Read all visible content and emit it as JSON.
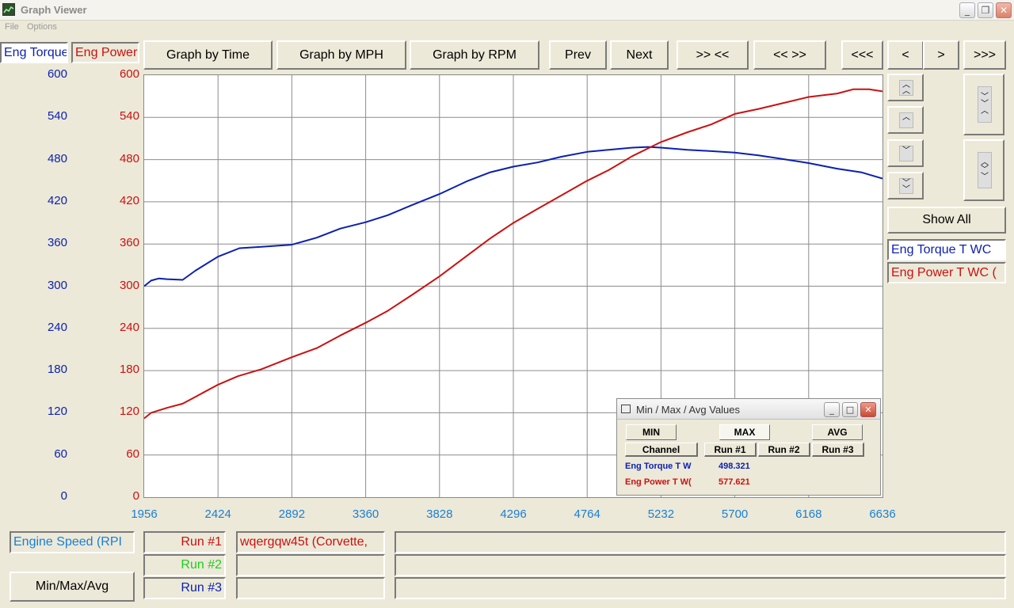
{
  "window": {
    "title": "Graph Viewer",
    "minimize_glyph": "_",
    "maximize_glyph": "❐",
    "close_glyph": "✕"
  },
  "menu": {
    "items": [
      "File",
      "Options"
    ]
  },
  "channels": {
    "left_torque": "Eng Torque",
    "left_power": "Eng Power",
    "right_torque": "Eng Torque T WC",
    "right_power": "Eng Power T WC ("
  },
  "toolbar": {
    "graph_by_time": "Graph by Time",
    "graph_by_mph": "Graph by MPH",
    "graph_by_rpm": "Graph by RPM",
    "prev": "Prev",
    "next": "Next",
    "zoom_in": ">> <<",
    "zoom_out": "<< >>",
    "scroll_far_left": "<<<",
    "scroll_left": "<",
    "scroll_right": ">",
    "scroll_far_right": ">>>"
  },
  "show_all": "Show All",
  "x_axis_channel": "Engine Speed (RPI",
  "runs": [
    {
      "label": "Run #1",
      "color": "#cc1010",
      "name": "wqergqw45t (Corvette,"
    },
    {
      "label": "Run #2",
      "color": "#22cc22",
      "name": ""
    },
    {
      "label": "Run #3",
      "color": "#0b1fb1",
      "name": ""
    }
  ],
  "minmax_button": "Min/Max/Avg",
  "dialog": {
    "title": "Min / Max / Avg Values",
    "min_label": "MIN",
    "max_label": "MAX",
    "avg_label": "AVG",
    "headers": [
      "Channel",
      "Run #1",
      "Run #2",
      "Run #3"
    ],
    "rows": [
      {
        "channel": "Eng Torque T W",
        "run1": "498.321",
        "color": "#0b1fb1"
      },
      {
        "channel": "Eng Power T W(",
        "run1": "577.621",
        "color": "#cc1010"
      }
    ]
  },
  "colors": {
    "torque": "#0b1fb1",
    "power": "#cc1010",
    "x_ticks": "#1a7fd4",
    "grid": "#8c8c8c"
  },
  "chart_data": {
    "type": "line",
    "xlabel": "Engine Speed (RPI",
    "x_ticks": [
      "1956",
      "2424",
      "2892",
      "3360",
      "3828",
      "4296",
      "4764",
      "5232",
      "5700",
      "6168",
      "6636"
    ],
    "y_ticks_torque": [
      "600",
      "540",
      "480",
      "420",
      "360",
      "300",
      "240",
      "180",
      "120",
      "60",
      "0"
    ],
    "y_ticks_power": [
      "600",
      "540",
      "480",
      "420",
      "360",
      "300",
      "240",
      "180",
      "120",
      "60",
      "0"
    ],
    "xlim": [
      1956,
      6636
    ],
    "ylim": [
      0,
      600
    ],
    "grid": true,
    "series": [
      {
        "name": "Eng Torque T WC",
        "color": "#0b1fb1",
        "x": [
          1956,
          2000,
          2050,
          2100,
          2200,
          2280,
          2424,
          2560,
          2700,
          2892,
          3050,
          3200,
          3360,
          3500,
          3650,
          3828,
          4000,
          4150,
          4296,
          4450,
          4600,
          4764,
          4900,
          5050,
          5150,
          5232,
          5400,
          5550,
          5700,
          5850,
          6000,
          6168,
          6350,
          6500,
          6636
        ],
        "y": [
          300,
          308,
          311,
          310,
          309,
          322,
          342,
          354,
          356,
          359,
          369,
          382,
          391,
          401,
          415,
          431,
          449,
          462,
          470,
          476,
          484,
          491,
          494,
          497,
          498,
          497,
          494,
          492,
          490,
          486,
          481,
          475,
          467,
          462,
          453
        ]
      },
      {
        "name": "Eng Power T WC (",
        "color": "#cc1010",
        "x": [
          1956,
          2000,
          2100,
          2200,
          2300,
          2424,
          2550,
          2700,
          2892,
          3050,
          3200,
          3360,
          3500,
          3650,
          3828,
          4000,
          4150,
          4296,
          4450,
          4600,
          4764,
          4900,
          5050,
          5232,
          5400,
          5550,
          5700,
          5850,
          6000,
          6168,
          6350,
          6450,
          6550,
          6636
        ],
        "y": [
          112,
          120,
          127,
          133,
          145,
          160,
          172,
          182,
          199,
          212,
          230,
          248,
          265,
          287,
          314,
          343,
          368,
          390,
          410,
          429,
          450,
          465,
          485,
          505,
          519,
          530,
          545,
          552,
          560,
          569,
          574,
          580,
          580,
          577
        ]
      }
    ]
  }
}
